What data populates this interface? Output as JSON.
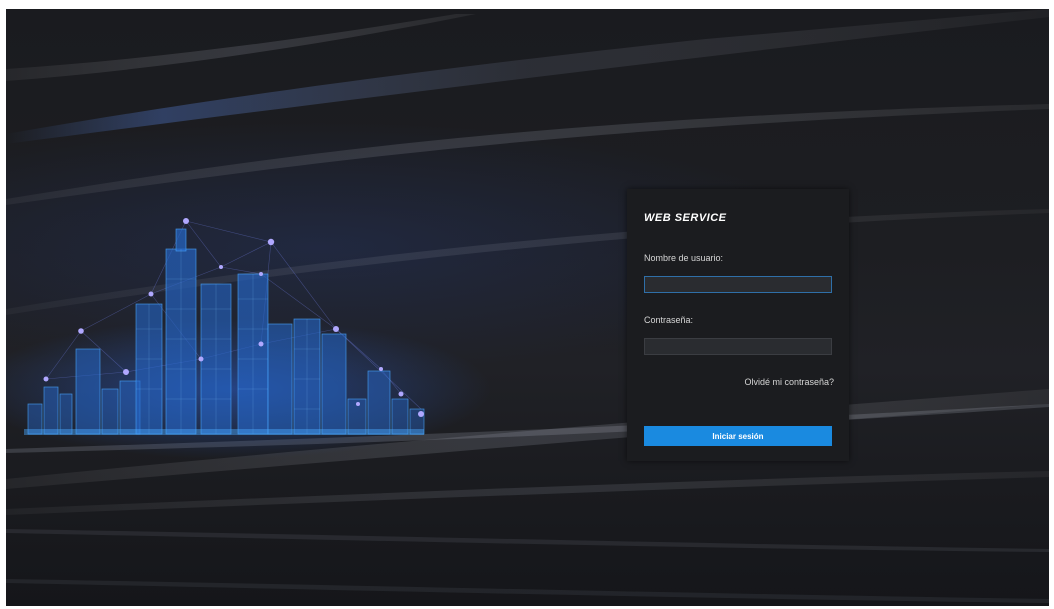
{
  "login": {
    "title": "WEB SERVICE",
    "username_label": "Nombre de usuario:",
    "username_value": "",
    "password_label": "Contraseña:",
    "password_value": "",
    "forgot_password": "Olvidé mi contraseña?",
    "submit_label": "Iniciar sesión"
  },
  "illustration": {
    "icon": "city-skyline-network-icon",
    "colors": {
      "building": "#2a6fd6",
      "glow": "#4aa8ff",
      "node": "#9a8cff"
    }
  },
  "colors": {
    "background": "#1d1e22",
    "panel": "#1b1c1f",
    "accent": "#1a8ae0",
    "input": "#2a2c30"
  }
}
